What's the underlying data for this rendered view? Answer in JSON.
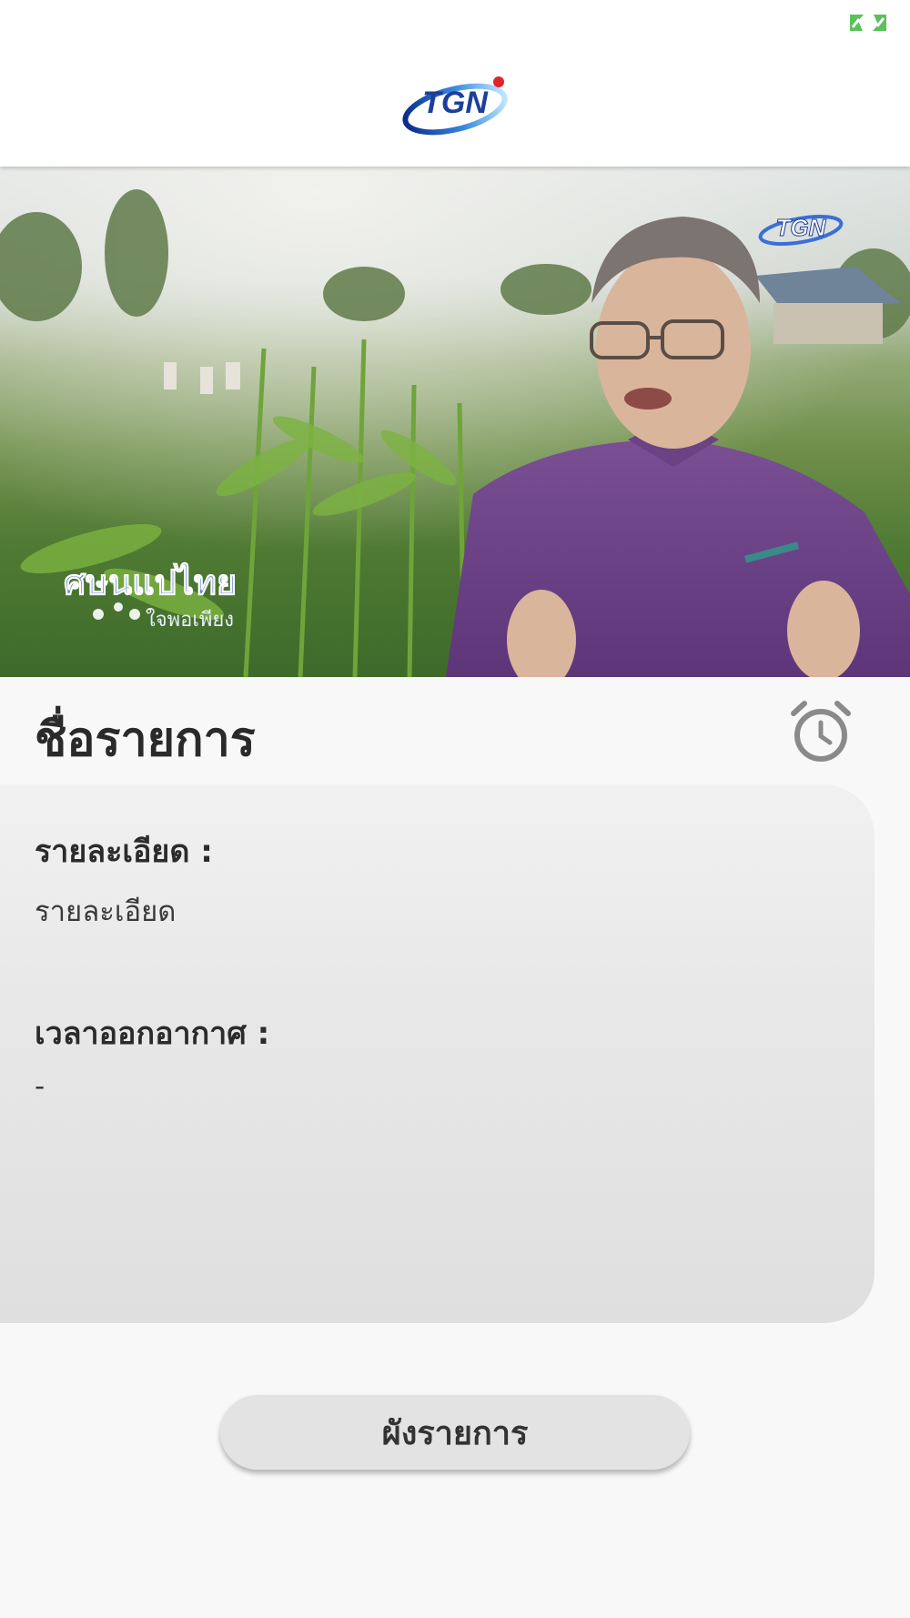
{
  "header": {
    "logo_text": "TGN",
    "fullscreen_icon": "expand-icon"
  },
  "video": {
    "watermark": "TGN",
    "caption_title": "ศษนแปไทย",
    "caption_subtitle": "ใจพอเพียง"
  },
  "program": {
    "title": "ชื่อรายการ",
    "alarm_icon": "alarm-clock-icon"
  },
  "details": {
    "description_label": "รายละเอียด :",
    "description_value": "รายละเอียด",
    "airtime_label": "เวลาออกอากาศ :",
    "airtime_value": "-"
  },
  "actions": {
    "schedule_label": "ผังรายการ"
  },
  "colors": {
    "accent_green": "#5cc05c",
    "logo_blue": "#1c3f9a",
    "alarm_gray": "#8a8a8a"
  }
}
